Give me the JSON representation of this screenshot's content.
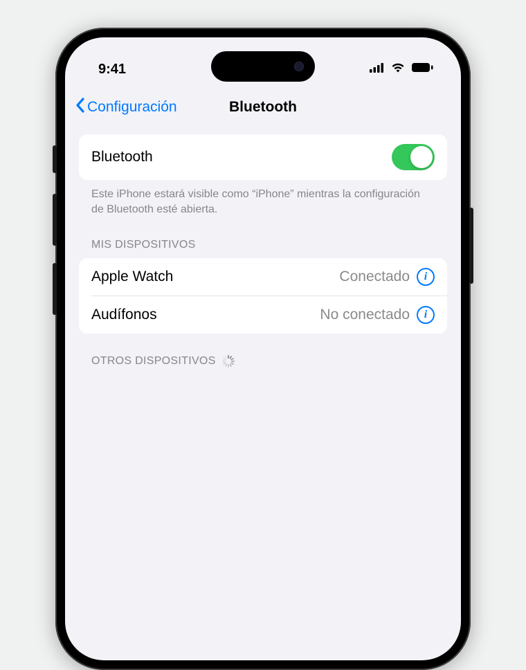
{
  "status": {
    "time": "9:41"
  },
  "nav": {
    "back_label": "Configuración",
    "title": "Bluetooth"
  },
  "bluetooth_toggle": {
    "label": "Bluetooth",
    "enabled": true
  },
  "visibility_note": "Este iPhone estará visible como “iPhone” mientras la configuración de Bluetooth esté abierta.",
  "sections": {
    "my_devices": {
      "header": "MIS DISPOSITIVOS",
      "items": [
        {
          "name": "Apple Watch",
          "status": "Conectado"
        },
        {
          "name": "Audífonos",
          "status": "No conectado"
        }
      ]
    },
    "other_devices": {
      "header": "OTROS DISPOSITIVOS"
    }
  },
  "colors": {
    "accent": "#007aff",
    "toggle_on": "#34c759",
    "background": "#f2f2f7",
    "secondary_text": "#86868b"
  }
}
